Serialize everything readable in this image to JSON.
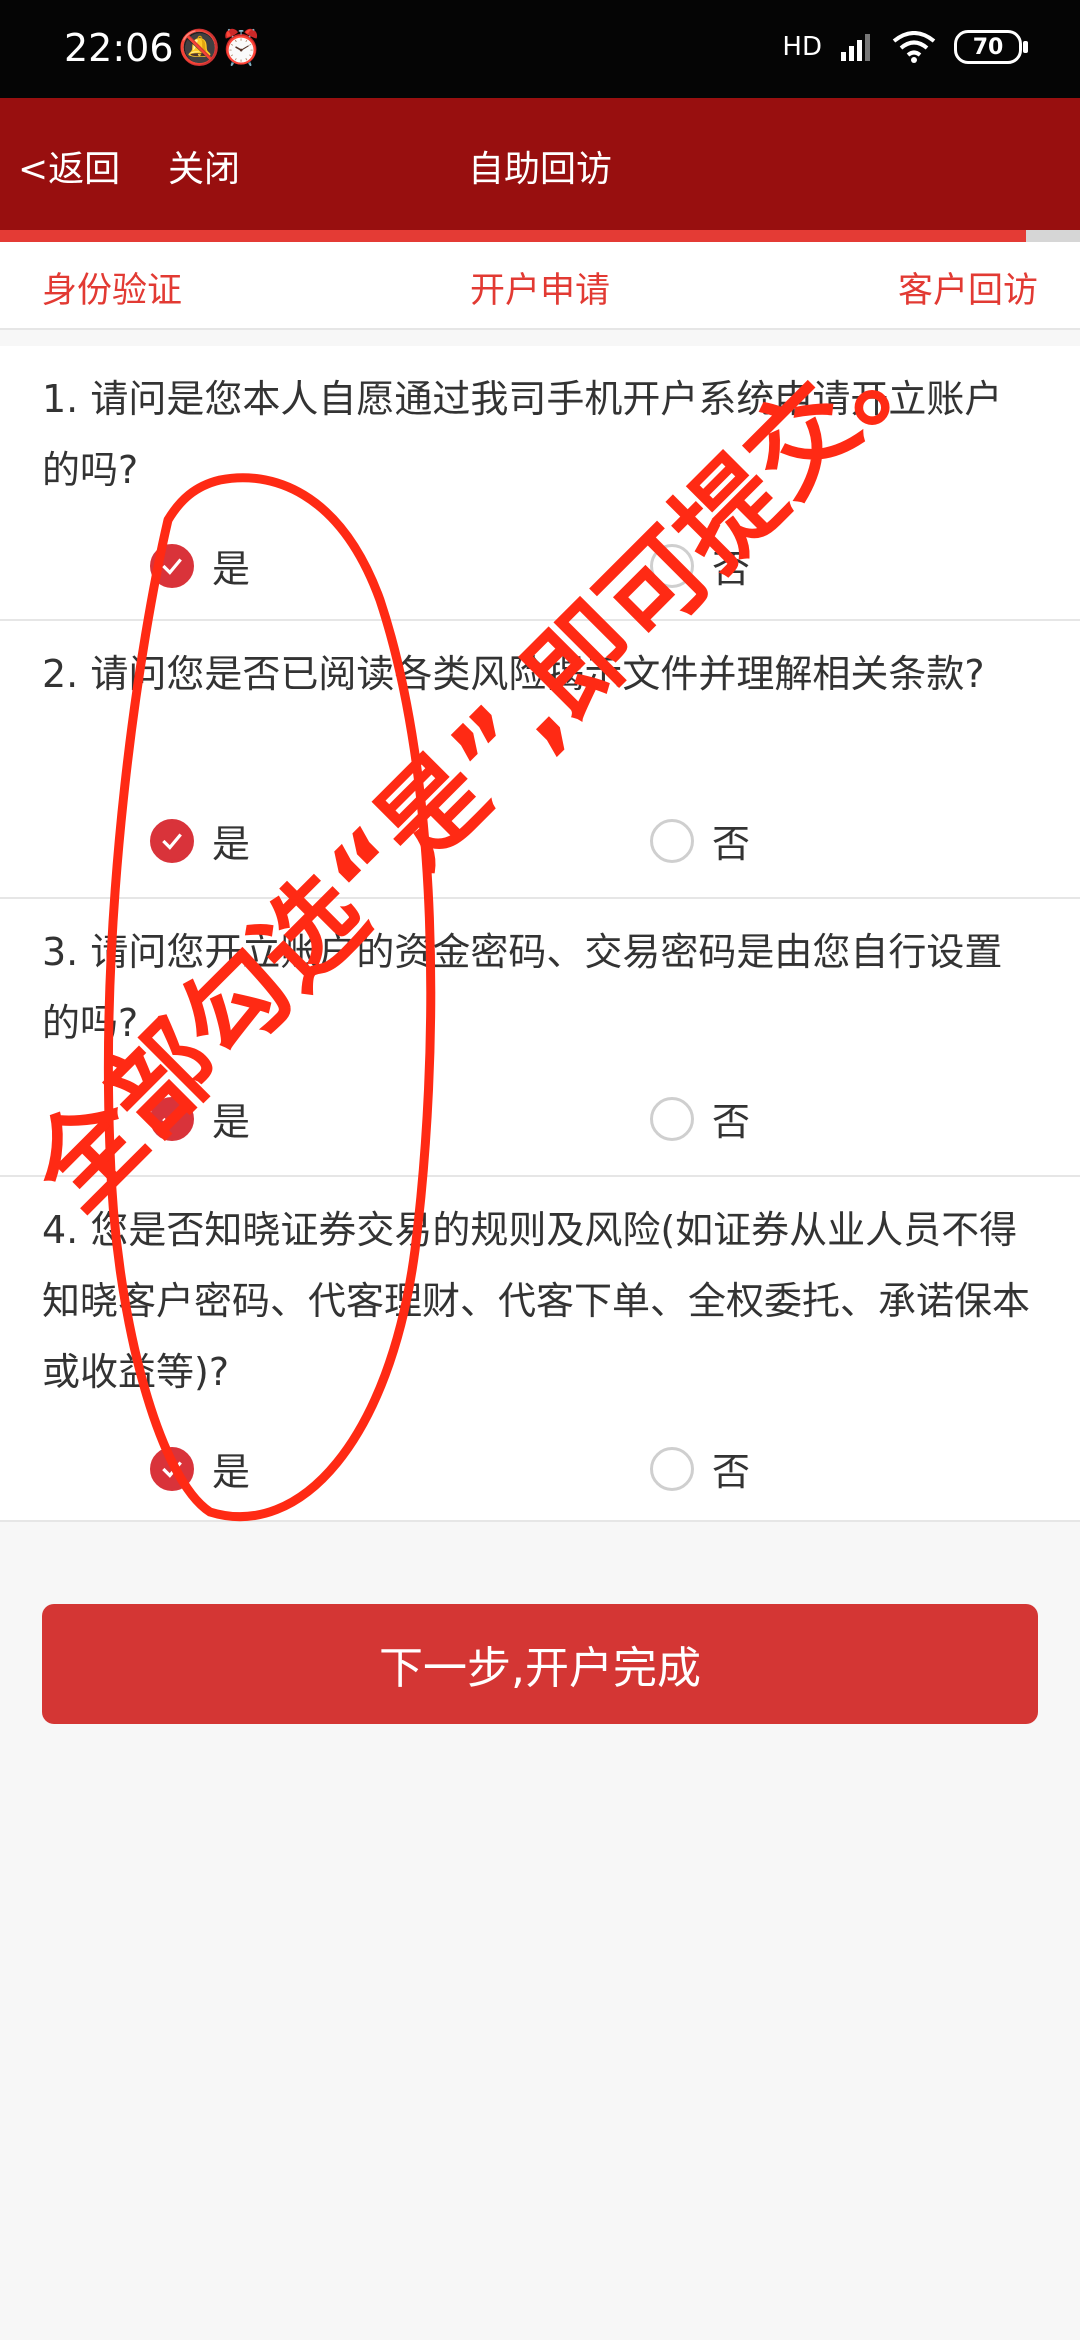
{
  "status_bar": {
    "time": "22:06",
    "left_icons": "🔕⏰",
    "network": "HD",
    "battery": "70"
  },
  "header": {
    "back": "<返回",
    "close": "关闭",
    "title": "自助回访"
  },
  "progress": {
    "value": 0.95
  },
  "steps": [
    "身份验证",
    "开户申请",
    "客户回访"
  ],
  "questions": [
    {
      "text": "1. 请问是您本人自愿通过我司手机开户系统申请开立账户的吗?",
      "yes": "是",
      "no": "否",
      "selected": "yes"
    },
    {
      "text": "2. 请问您是否已阅读各类风险揭示文件并理解相关条款?",
      "yes": "是",
      "no": "否",
      "selected": "yes"
    },
    {
      "text": "3. 请问您开立账户的资金密码、交易密码是由您自行设置的吗?",
      "yes": "是",
      "no": "否",
      "selected": "yes"
    },
    {
      "text": "4. 您是否知晓证券交易的规则及风险(如证券从业人员不得知晓客户密码、代客理财、代客下单、全权委托、承诺保本或收益等)?",
      "yes": "是",
      "no": "否",
      "selected": "yes"
    }
  ],
  "submit": {
    "label": "下一步,开户完成"
  },
  "annotation": {
    "text": "全部勾选“是”,即可提交。",
    "color": "#ff2a14"
  },
  "colors": {
    "header": "#980f0f",
    "accent": "#d9333a"
  }
}
